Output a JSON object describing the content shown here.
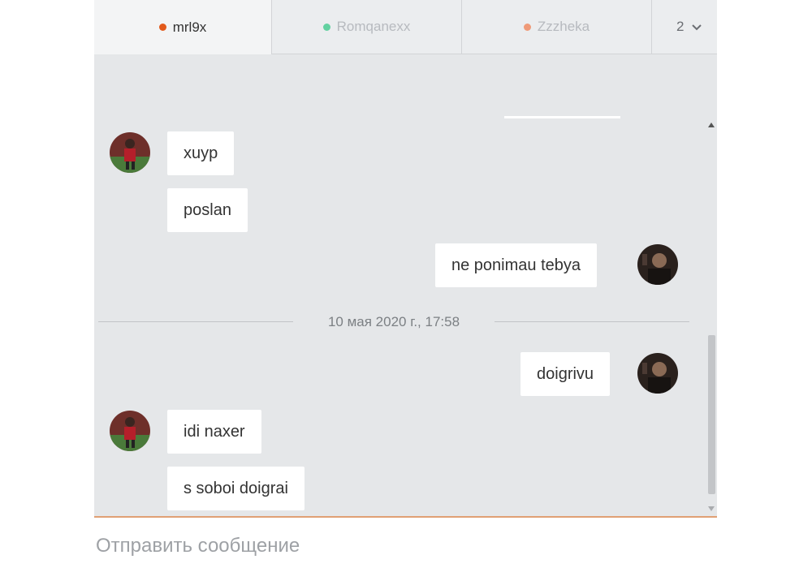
{
  "tabs": [
    {
      "label": "mrl9x",
      "dot_color": "#e25a1c",
      "active": true
    },
    {
      "label": "Romqanexx",
      "dot_color": "#62d1a0",
      "active": false
    },
    {
      "label": "Zzzheka",
      "dot_color": "#ef9a78",
      "active": false
    }
  ],
  "more_tab": {
    "count": "2",
    "icon": "chevron-down-icon"
  },
  "messages": [
    {
      "sender": "contact",
      "text": "xuyp"
    },
    {
      "sender": "contact",
      "text": "poslan"
    },
    {
      "sender": "self",
      "text": "ne ponimau tebya"
    },
    {
      "sender": "self",
      "text": "doigrivu"
    },
    {
      "sender": "contact",
      "text": "idi naxer"
    },
    {
      "sender": "contact",
      "text": "s soboi doigrai"
    }
  ],
  "date_separator": "10 мая 2020 г., 17:58",
  "composer": {
    "placeholder": "Отправить сообщение",
    "value": ""
  }
}
